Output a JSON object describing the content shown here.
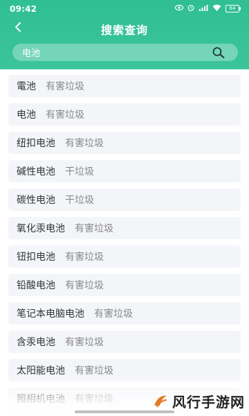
{
  "status": {
    "time": "09:42",
    "battery": "84"
  },
  "header": {
    "title": "搜索查询"
  },
  "search": {
    "value": "电池"
  },
  "results": [
    {
      "name": "電池",
      "category": "有害垃圾"
    },
    {
      "name": "电池",
      "category": "有害垃圾"
    },
    {
      "name": "纽扣电池",
      "category": "有害垃圾"
    },
    {
      "name": "碱性电池",
      "category": "干垃圾"
    },
    {
      "name": "碳性电池",
      "category": "干垃圾"
    },
    {
      "name": "氧化汞电池",
      "category": "有害垃圾"
    },
    {
      "name": "钮扣电池",
      "category": "有害垃圾"
    },
    {
      "name": "铅酸电池",
      "category": "有害垃圾"
    },
    {
      "name": "笔记本电脑电池",
      "category": "有害垃圾"
    },
    {
      "name": "含汞电池",
      "category": "有害垃圾"
    },
    {
      "name": "太阳能电池",
      "category": "有害垃圾"
    },
    {
      "name": "照相机电池",
      "category": "有害垃圾"
    }
  ],
  "watermark": {
    "text": "风行手游网"
  },
  "colors": {
    "accent": "#33c197",
    "row_bg": "#f3f5f9",
    "name_text": "#333333",
    "category_text": "#888888"
  }
}
